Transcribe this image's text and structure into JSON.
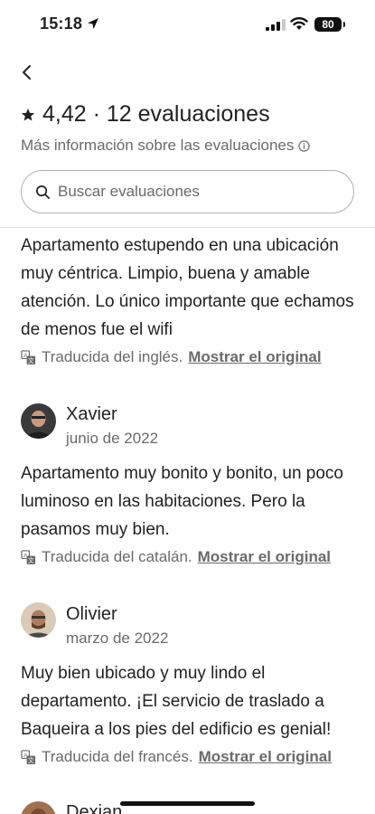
{
  "status_bar": {
    "time": "15:18",
    "battery": "80"
  },
  "header": {
    "rating_title": "4,42 · 12 evaluaciones",
    "more_info": "Más información sobre las evaluaciones"
  },
  "search": {
    "placeholder": "Buscar evaluaciones"
  },
  "reviews": [
    {
      "text": "Apartamento estupendo en una ubicación muy céntrica. Limpio, buena y amable atención. Lo único importante que echamos de menos fue el wifi",
      "translated": "Traducida del inglés.",
      "show_original": "Mostrar el original"
    },
    {
      "name": "Xavier",
      "date": "junio de 2022",
      "text": "Apartamento muy bonito y bonito, un poco luminoso en las habitaciones. Pero la pasamos muy bien.",
      "translated": "Traducida del catalán.",
      "show_original": "Mostrar el original"
    },
    {
      "name": "Olivier",
      "date": "marzo de 2022",
      "text": "Muy bien ubicado y muy lindo el departamento. ¡El servicio de traslado a Baqueira a los pies del edificio es genial!",
      "translated": "Traducida del francés.",
      "show_original": "Mostrar el original"
    },
    {
      "name": "Dexian"
    }
  ]
}
